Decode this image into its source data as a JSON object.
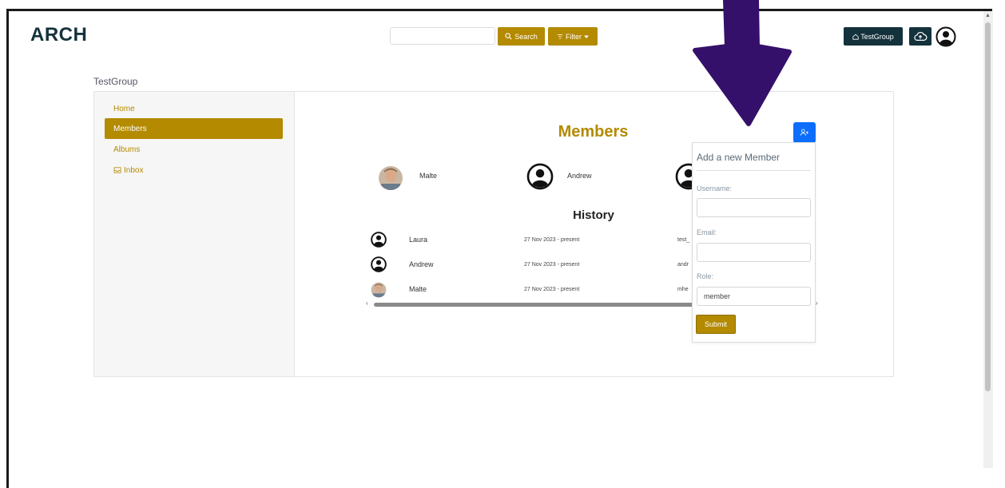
{
  "app": {
    "brand": "ARCH"
  },
  "header": {
    "search_value": "",
    "search_label": "Search",
    "filter_label": "Filter",
    "group_label": "TestGroup"
  },
  "breadcrumb": "TestGroup",
  "sidebar": {
    "items": [
      {
        "label": "Home",
        "active": false
      },
      {
        "label": "Members",
        "active": true
      },
      {
        "label": "Albums",
        "active": false
      },
      {
        "label": "Inbox",
        "active": false,
        "icon": "inbox-icon"
      }
    ]
  },
  "main": {
    "title": "Members",
    "members": [
      {
        "name": "Malte",
        "avatar": "photo"
      },
      {
        "name": "Andrew",
        "avatar": "default"
      },
      {
        "name": "",
        "avatar": "default"
      }
    ],
    "history": {
      "title": "History",
      "rows": [
        {
          "name": "Laura",
          "period": "27 Nov 2023 - present",
          "username": "test_"
        },
        {
          "name": "Andrew",
          "period": "27 Nov 2023 - present",
          "username": "andr"
        },
        {
          "name": "Malte",
          "period": "27 Nov 2023 - present",
          "username": "mhe"
        }
      ]
    }
  },
  "add_member": {
    "title": "Add a new Member",
    "username_label": "Username:",
    "username_value": "",
    "email_label": "Email:",
    "email_value": "",
    "role_label": "Role:",
    "role_value": "member",
    "submit_label": "Submit"
  },
  "colors": {
    "accent": "#b38a00",
    "dark": "#14323c",
    "primary_blue": "#0d6efd",
    "arrow": "#35106b"
  }
}
